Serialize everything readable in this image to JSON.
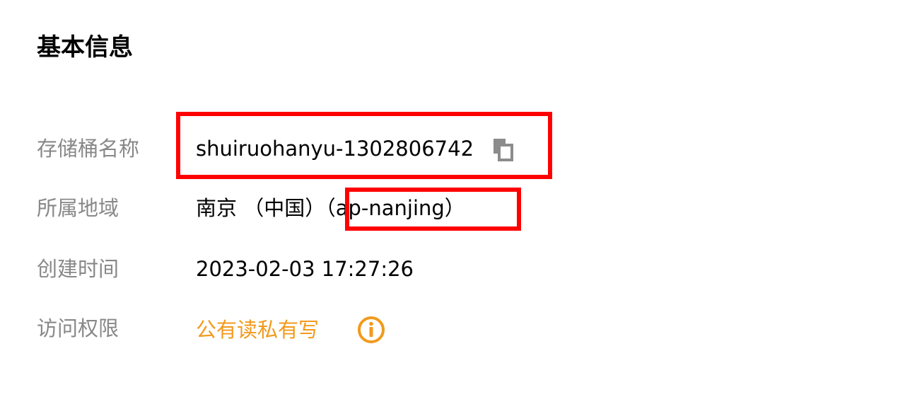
{
  "section": {
    "title": "基本信息"
  },
  "fields": {
    "bucket_name": {
      "label": "存储桶名称",
      "value": "shuiruohanyu-1302806742",
      "action_icon": "copy-icon"
    },
    "region": {
      "label": "所属地域",
      "value": "南京 （中国）（ap-nanjing）"
    },
    "created_at": {
      "label": "创建时间",
      "value": "2023-02-03 17:27:26"
    },
    "access": {
      "label": "访问权限",
      "value": "公有读私有写",
      "info_icon": "info-icon"
    }
  },
  "colors": {
    "label": "#888888",
    "value": "#000000",
    "access_link": "#f29a1c",
    "highlight": "#ff0000",
    "copy_icon": "#8c8c8c"
  }
}
